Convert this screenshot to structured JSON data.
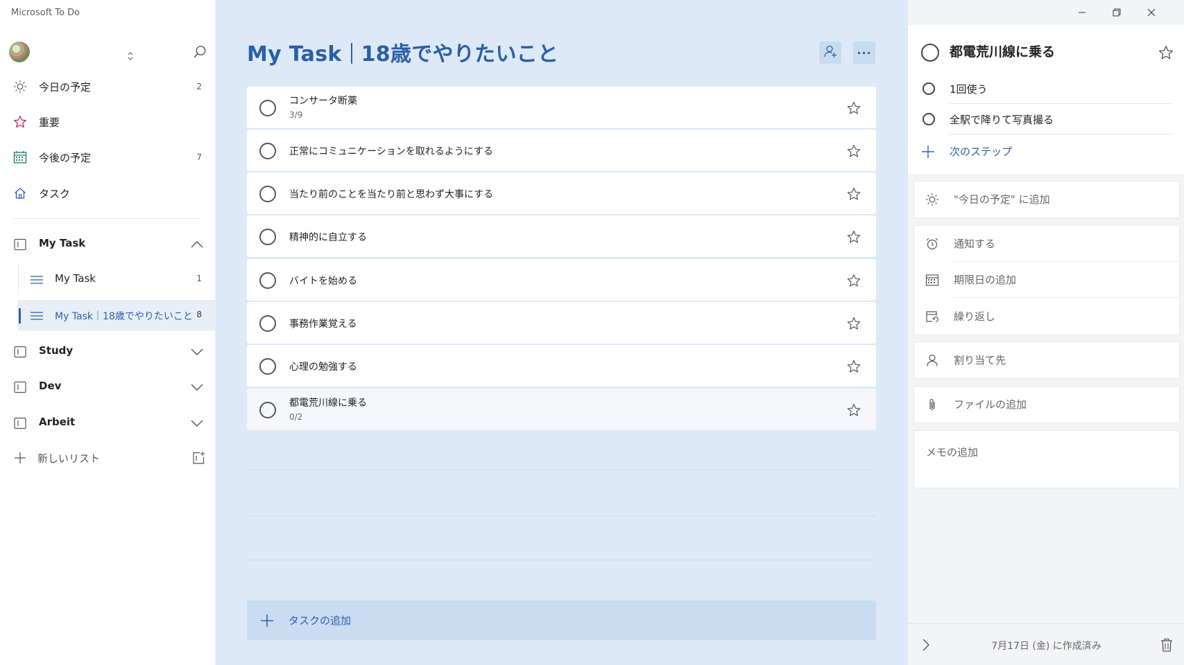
{
  "app": {
    "title": "Microsoft To Do"
  },
  "sidebar": {
    "account_switch_icon": "chevron-up-down-icon",
    "search_icon": "search-icon",
    "smart_lists": [
      {
        "label": "今日の予定",
        "count": "2",
        "icon": "sun-icon"
      },
      {
        "label": "重要",
        "count": "",
        "icon": "star-icon"
      },
      {
        "label": "今後の予定",
        "count": "7",
        "icon": "calendar-icon"
      },
      {
        "label": "タスク",
        "count": "",
        "icon": "home-icon"
      }
    ],
    "groups": [
      {
        "label": "My Task",
        "expanded": true,
        "items": [
          {
            "label": "My Task",
            "count": "1"
          },
          {
            "label": "My Task｜18歳でやりたいこと",
            "count": "8",
            "active": true
          }
        ]
      },
      {
        "label": "Study",
        "expanded": false
      },
      {
        "label": "Dev",
        "expanded": false
      },
      {
        "label": "Arbeit",
        "expanded": false
      }
    ],
    "new_list_label": "新しいリスト"
  },
  "main": {
    "title_left": "My Task",
    "title_right": "18歳でやりたいこと",
    "more_label": "···",
    "tasks": [
      {
        "title": "コンサータ断薬",
        "subtitle": "3/9"
      },
      {
        "title": "正常にコミュニケーションを取れるようにする",
        "subtitle": ""
      },
      {
        "title": "当たり前のことを当たり前と思わず大事にする",
        "subtitle": ""
      },
      {
        "title": "精神的に自立する",
        "subtitle": ""
      },
      {
        "title": "バイトを始める",
        "subtitle": ""
      },
      {
        "title": "事務作業覚える",
        "subtitle": ""
      },
      {
        "title": "心理の勉強する",
        "subtitle": ""
      },
      {
        "title": "都電荒川線に乗る",
        "subtitle": "0/2",
        "selected": true
      }
    ],
    "add_task_label": "タスクの追加"
  },
  "detail": {
    "title": "都電荒川線に乗る",
    "steps": [
      {
        "label": "1回使う"
      },
      {
        "label": "全駅で降りて写真撮る"
      }
    ],
    "next_step_label": "次のステップ",
    "add_to_my_day": "\"今日の予定\" に追加",
    "remind_me": "通知する",
    "add_due_date": "期限日の追加",
    "repeat": "繰り返し",
    "assign_to": "割り当て先",
    "add_file": "ファイルの追加",
    "add_note": "メモの追加",
    "created": "7月17日 (金) に作成済み"
  },
  "colors": {
    "accent": "#2b5fa7",
    "main_bg": "#dde9f6",
    "add_bar": "#c9dcf1"
  }
}
